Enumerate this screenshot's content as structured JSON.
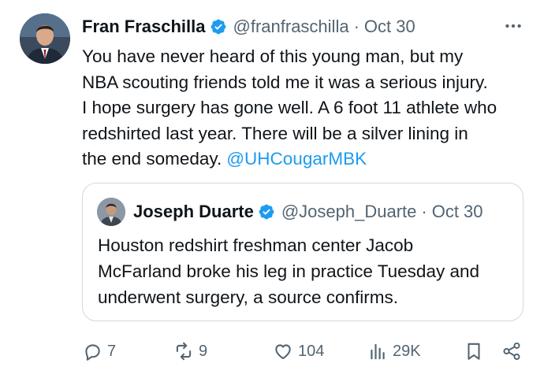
{
  "tweet": {
    "author_name": "Fran Fraschilla",
    "author_handle": "@franfraschilla",
    "separator": "·",
    "date": "Oct 30",
    "text_lines": [
      "You have never heard of this young man, but my",
      "NBA scouting friends told me it was a serious injury.",
      "I hope surgery has gone well. A 6 foot 11 athlete who",
      "redshirted last year. There will be a silver lining in",
      "the end someday."
    ],
    "mention": "@UHCougarMBK"
  },
  "quote": {
    "author_name": "Joseph Duarte",
    "author_handle": "@Joseph_Duarte",
    "separator": "·",
    "date": "Oct 30",
    "text_lines": [
      "Houston redshirt freshman center Jacob",
      "McFarland broke his leg in practice Tuesday and",
      "underwent surgery, a source confirms."
    ]
  },
  "actions": {
    "replies": "7",
    "retweets": "9",
    "likes": "104",
    "views": "29K"
  },
  "icons": {
    "more": "more-horizontal-icon",
    "reply": "reply-icon",
    "retweet": "retweet-icon",
    "like": "heart-icon",
    "views": "views-icon",
    "bookmark": "bookmark-icon",
    "share": "share-icon",
    "verified": "verified-badge-icon"
  },
  "colors": {
    "text": "#0f1419",
    "secondary": "#536471",
    "link": "#1d9bf0",
    "border": "#cfd9de",
    "verified": "#1d9bf0"
  }
}
